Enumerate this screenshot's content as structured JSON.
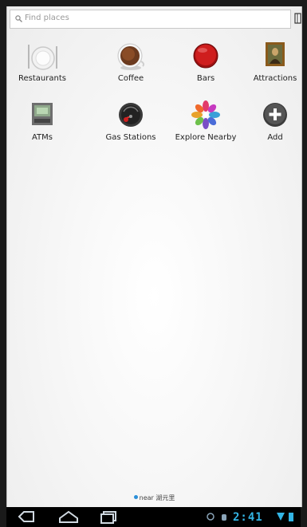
{
  "search": {
    "placeholder": "Find places"
  },
  "categories": [
    {
      "label": "Restaurants",
      "icon": "plate-icon"
    },
    {
      "label": "Coffee",
      "icon": "coffee-cup-icon"
    },
    {
      "label": "Bars",
      "icon": "bar-stool-icon"
    },
    {
      "label": "Attractions",
      "icon": "painting-icon"
    },
    {
      "label": "ATMs",
      "icon": "atm-icon"
    },
    {
      "label": "Gas Stations",
      "icon": "gas-gauge-icon"
    },
    {
      "label": "Explore Nearby",
      "icon": "flower-icon"
    },
    {
      "label": "Add",
      "icon": "add-icon"
    }
  ],
  "footer": {
    "location_text": "near 湖元里"
  },
  "statusbar": {
    "time": "2:41"
  },
  "colors": {
    "accent": "#33b5e5",
    "location_dot": "#2a8fd8"
  }
}
